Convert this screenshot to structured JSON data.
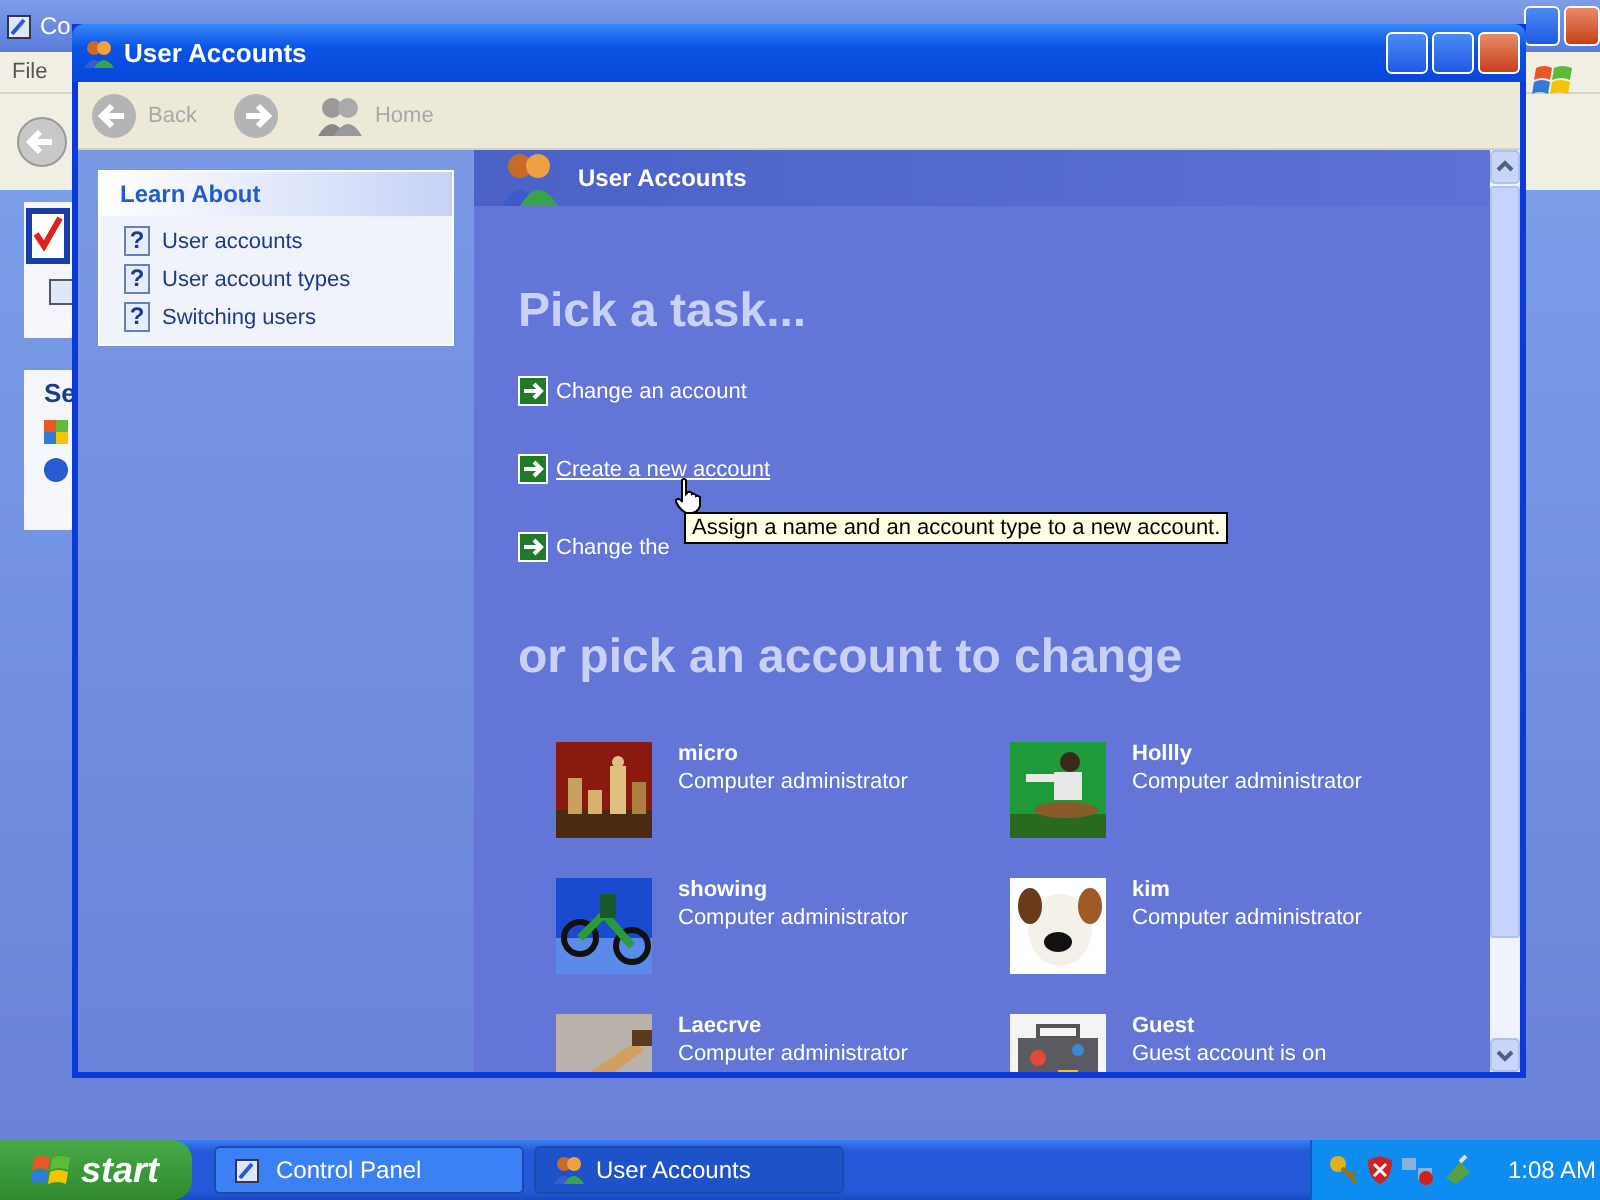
{
  "background_window": {
    "title": "Co",
    "menu": [
      "File"
    ],
    "side_panel_title": "Se"
  },
  "window": {
    "title": "User Accounts",
    "toolbar": [
      {
        "kind": "back",
        "label": "Back",
        "disabled": true
      },
      {
        "kind": "forward",
        "disabled": true
      },
      {
        "kind": "home",
        "label": "Home",
        "disabled": true
      }
    ]
  },
  "learn_about": {
    "title": "Learn About",
    "items": [
      {
        "icon": "?",
        "label": "User accounts"
      },
      {
        "icon": "?",
        "label": "User account types"
      },
      {
        "icon": "?",
        "label": "Switching users"
      }
    ]
  },
  "header": {
    "title": "User Accounts"
  },
  "task_heading": "Pick a task...",
  "tasks": [
    {
      "label": "Change an account",
      "hovered": false
    },
    {
      "label": "Create a new account",
      "hovered": true
    },
    {
      "label": "Change the",
      "hovered": false
    }
  ],
  "tooltip": "Assign a name and an account type to a new account.",
  "accounts_heading": "or pick an account to change",
  "accounts": [
    {
      "name": "micro",
      "type": "Computer administrator"
    },
    {
      "name": "Hollly",
      "type": "Computer administrator"
    },
    {
      "name": "showing",
      "type": "Computer administrator"
    },
    {
      "name": "kim",
      "type": "Computer administrator"
    },
    {
      "name": "Laecrve",
      "type": "Computer administrator"
    },
    {
      "name": "Guest",
      "type": "Guest account is on"
    }
  ],
  "taskbar": {
    "start": "start",
    "buttons": [
      {
        "kind": "control-panel",
        "label": "Control Panel",
        "selected": false
      },
      {
        "kind": "users",
        "label": "User Accounts",
        "selected": true
      }
    ],
    "clock": "1:08 AM"
  }
}
